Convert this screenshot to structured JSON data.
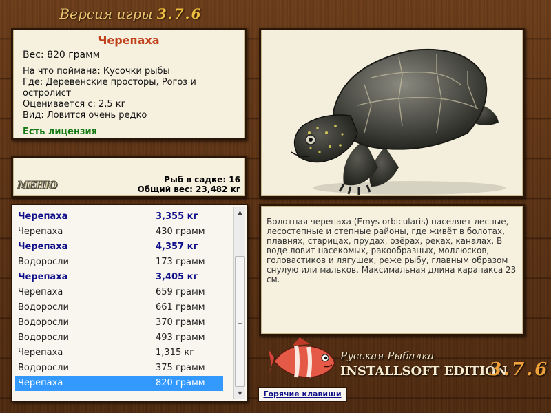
{
  "header": {
    "version_label": "Версия игры",
    "version_number": "3.7.6"
  },
  "fish_info": {
    "title": "Черепаха",
    "weight": "Вес: 820 грамм",
    "lines": [
      "На что поймана: Кусочки рыбы",
      "Где: Деревенские просторы, Рогоз и",
      "остролист",
      "Оценивается с: 2,5 кг",
      "Вид: Ловится очень редко"
    ],
    "license": "Есть лицензия"
  },
  "stats": {
    "menu_label": "МЕНЮ",
    "fish_count": "Рыб в садке: 16",
    "total_weight": "Общий вес: 23,482 кг"
  },
  "catch_list": {
    "rows": [
      {
        "name": "Черепаха",
        "weight": "3,355 кг"
      },
      {
        "name": "Черепаха",
        "weight": "430 грамм"
      },
      {
        "name": "Черепаха",
        "weight": "4,357 кг"
      },
      {
        "name": "Водоросли",
        "weight": "173 грамм"
      },
      {
        "name": "Черепаха",
        "weight": "3,405 кг"
      },
      {
        "name": "Черепаха",
        "weight": "659 грамм"
      },
      {
        "name": "Водоросли",
        "weight": "661 грамм"
      },
      {
        "name": "Водоросли",
        "weight": "370 грамм"
      },
      {
        "name": "Водоросли",
        "weight": "493 грамм"
      },
      {
        "name": "Черепаха",
        "weight": "1,315 кг"
      },
      {
        "name": "Водоросли",
        "weight": "375 грамм"
      },
      {
        "name": "Черепаха",
        "weight": "820 грамм"
      }
    ],
    "bold_indices": [
      0,
      2,
      4
    ],
    "selected_index": 11
  },
  "description": "Болотная черепаха (Emys orbicularis) населяет лесные, лесостепные и степные районы, где живёт в болотах, плавнях, старицах, прудах, озёрах, реках, каналах. В воде ловит насекомых, ракообразных, моллюсков, головастиков и лягушек, реже рыбу, главным образом снулую или мальков. Максимальная длина карапакса 23 см.",
  "branding": {
    "line1": "Русская Рыбалка",
    "line2": "INSTALLSOFT EDITION",
    "version": "3.7.6"
  },
  "hotkeys_label": "Горячие клавиши",
  "icons": {
    "scroll_up": "triangle-up-icon",
    "scroll_down": "triangle-down-icon"
  },
  "colors": {
    "title_orange": "#c0401a",
    "license_green": "#157a15",
    "bold_navy": "#10108a",
    "selection_blue": "#3399ff"
  }
}
